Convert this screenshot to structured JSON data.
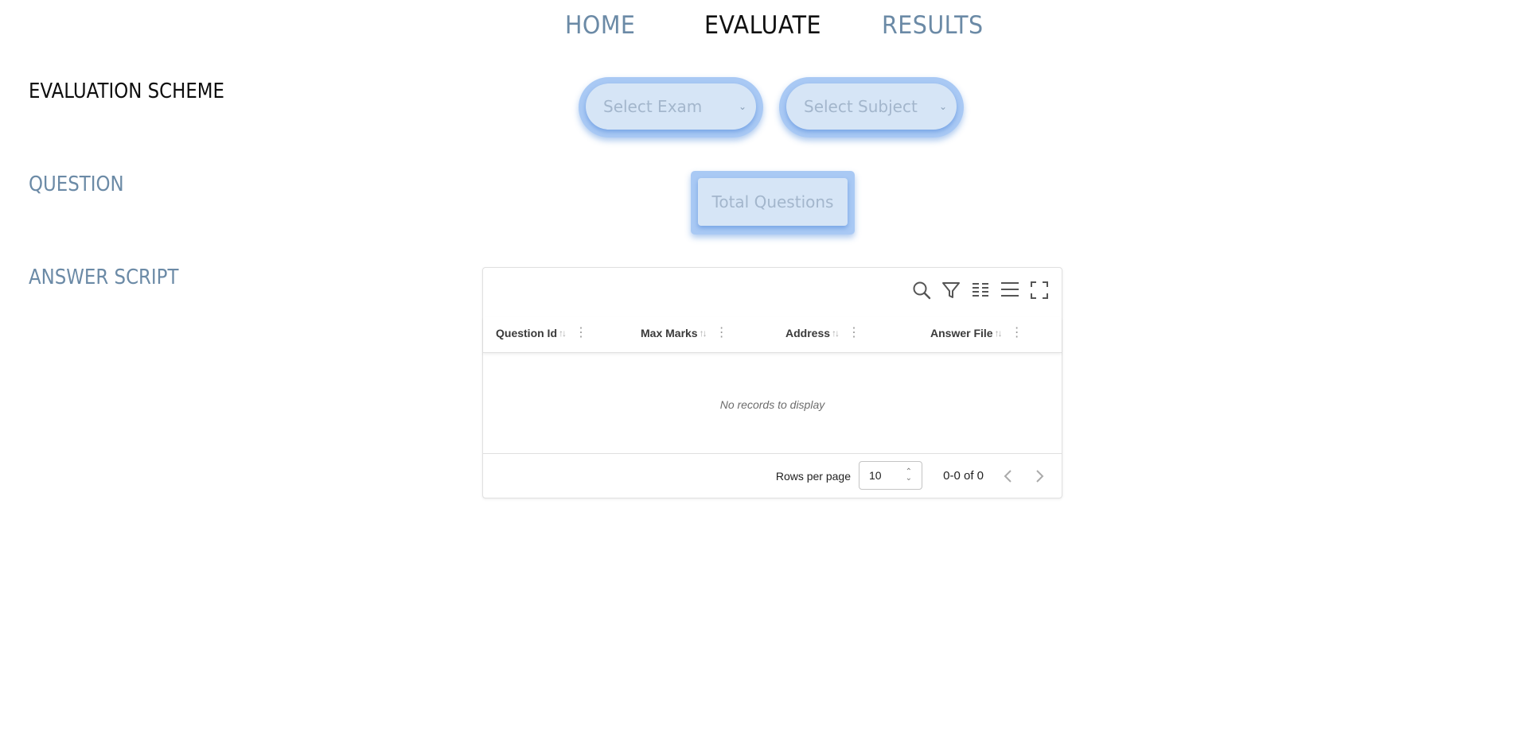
{
  "nav": {
    "items": [
      {
        "label": "HOME",
        "active": false
      },
      {
        "label": "EVALUATE",
        "active": true
      },
      {
        "label": "RESULTS",
        "active": false
      }
    ]
  },
  "sections": {
    "evaluation_scheme": "EVALUATION SCHEME",
    "question": "QUESTION",
    "answer_script": "ANSWER SCRIPT"
  },
  "selects": {
    "exam": {
      "placeholder": "Select Exam"
    },
    "subject": {
      "placeholder": "Select Subject"
    }
  },
  "total_questions_label": "Total Questions",
  "table": {
    "toolbar_icons": [
      "search-icon",
      "filter-icon",
      "columns-icon",
      "density-icon",
      "fullscreen-icon"
    ],
    "columns": [
      {
        "label": "Question Id"
      },
      {
        "label": "Max Marks"
      },
      {
        "label": "Address"
      },
      {
        "label": "Answer File"
      }
    ],
    "empty_text": "No records to display",
    "pagination": {
      "rows_per_page_label": "Rows per page",
      "rows_per_page_value": "10",
      "range_text": "0-0 of 0"
    }
  },
  "colors": {
    "nav_inactive": "#6b8aa6",
    "nav_active": "#111111",
    "pill_outer": "#a9c9f4",
    "pill_inner": "#d6e5f6"
  }
}
